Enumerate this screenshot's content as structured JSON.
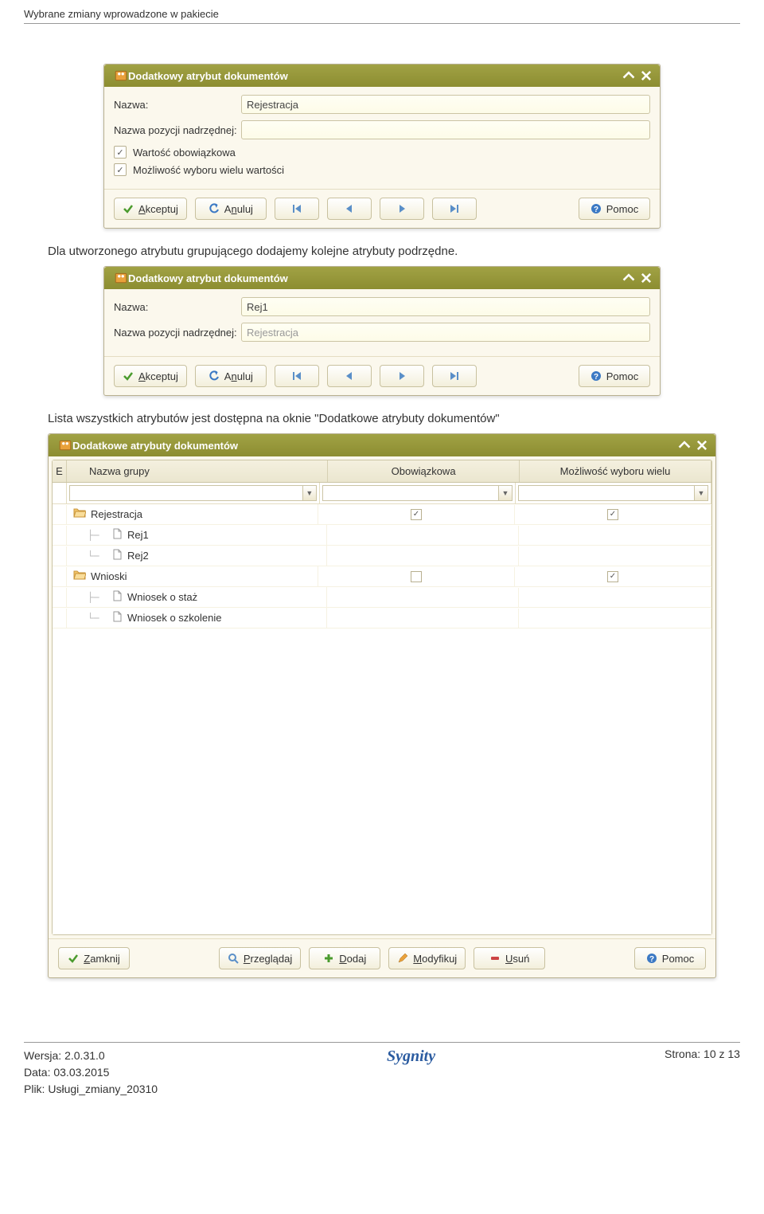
{
  "page": {
    "header": "Wybrane zmiany wprowadzone w pakiecie",
    "text_1": "Dla utworzonego atrybutu grupującego dodajemy kolejne atrybuty podrzędne.",
    "text_2": "Lista wszystkich atrybutów jest dostępna na oknie \"Dodatkowe atrybuty dokumentów\""
  },
  "dialog1": {
    "title": "Dodatkowy atrybut dokumentów",
    "name_label": "Nazwa:",
    "name_value": "Rejestracja",
    "parent_label": "Nazwa pozycji nadrzędnej:",
    "parent_value": "",
    "check_required": "Wartość obowiązkowa",
    "check_multi": "Możliwość wyboru wielu wartości",
    "buttons": {
      "accept": "Akceptuj",
      "cancel": "Anuluj",
      "help": "Pomoc"
    }
  },
  "dialog2": {
    "title": "Dodatkowy atrybut dokumentów",
    "name_label": "Nazwa:",
    "name_value": "Rej1",
    "parent_label": "Nazwa pozycji nadrzędnej:",
    "parent_value": "Rejestracja",
    "buttons": {
      "accept": "Akceptuj",
      "cancel": "Anuluj",
      "help": "Pomoc"
    }
  },
  "dialog3": {
    "title": "Dodatkowe atrybuty dokumentów",
    "columns": {
      "name": "Nazwa grupy",
      "required": "Obowiązkowa",
      "multi": "Możliwość wyboru wielu"
    },
    "rows": [
      {
        "type": "folder",
        "label": "Rejestracja",
        "required": true,
        "multi": true,
        "indent": 0
      },
      {
        "type": "doc",
        "label": "Rej1",
        "indent": 1
      },
      {
        "type": "doc",
        "label": "Rej2",
        "indent": 1
      },
      {
        "type": "folder",
        "label": "Wnioski",
        "required": false,
        "multi": true,
        "indent": 0
      },
      {
        "type": "doc",
        "label": "Wniosek o staż",
        "indent": 1
      },
      {
        "type": "doc",
        "label": "Wniosek o szkolenie",
        "indent": 1
      }
    ],
    "buttons": {
      "close": "Zamknij",
      "browse": "Przeglądaj",
      "add": "Dodaj",
      "modify": "Modyfikuj",
      "delete": "Usuń",
      "help": "Pomoc"
    }
  },
  "footer": {
    "version_label": "Wersja:",
    "version": "2.0.31.0",
    "date_label": "Data:",
    "date": "03.03.2015",
    "file_label": "Plik:",
    "file": "Usługi_zmiany_20310",
    "page_label": "Strona:",
    "page": "10 z 13",
    "brand": "Sygnity"
  }
}
